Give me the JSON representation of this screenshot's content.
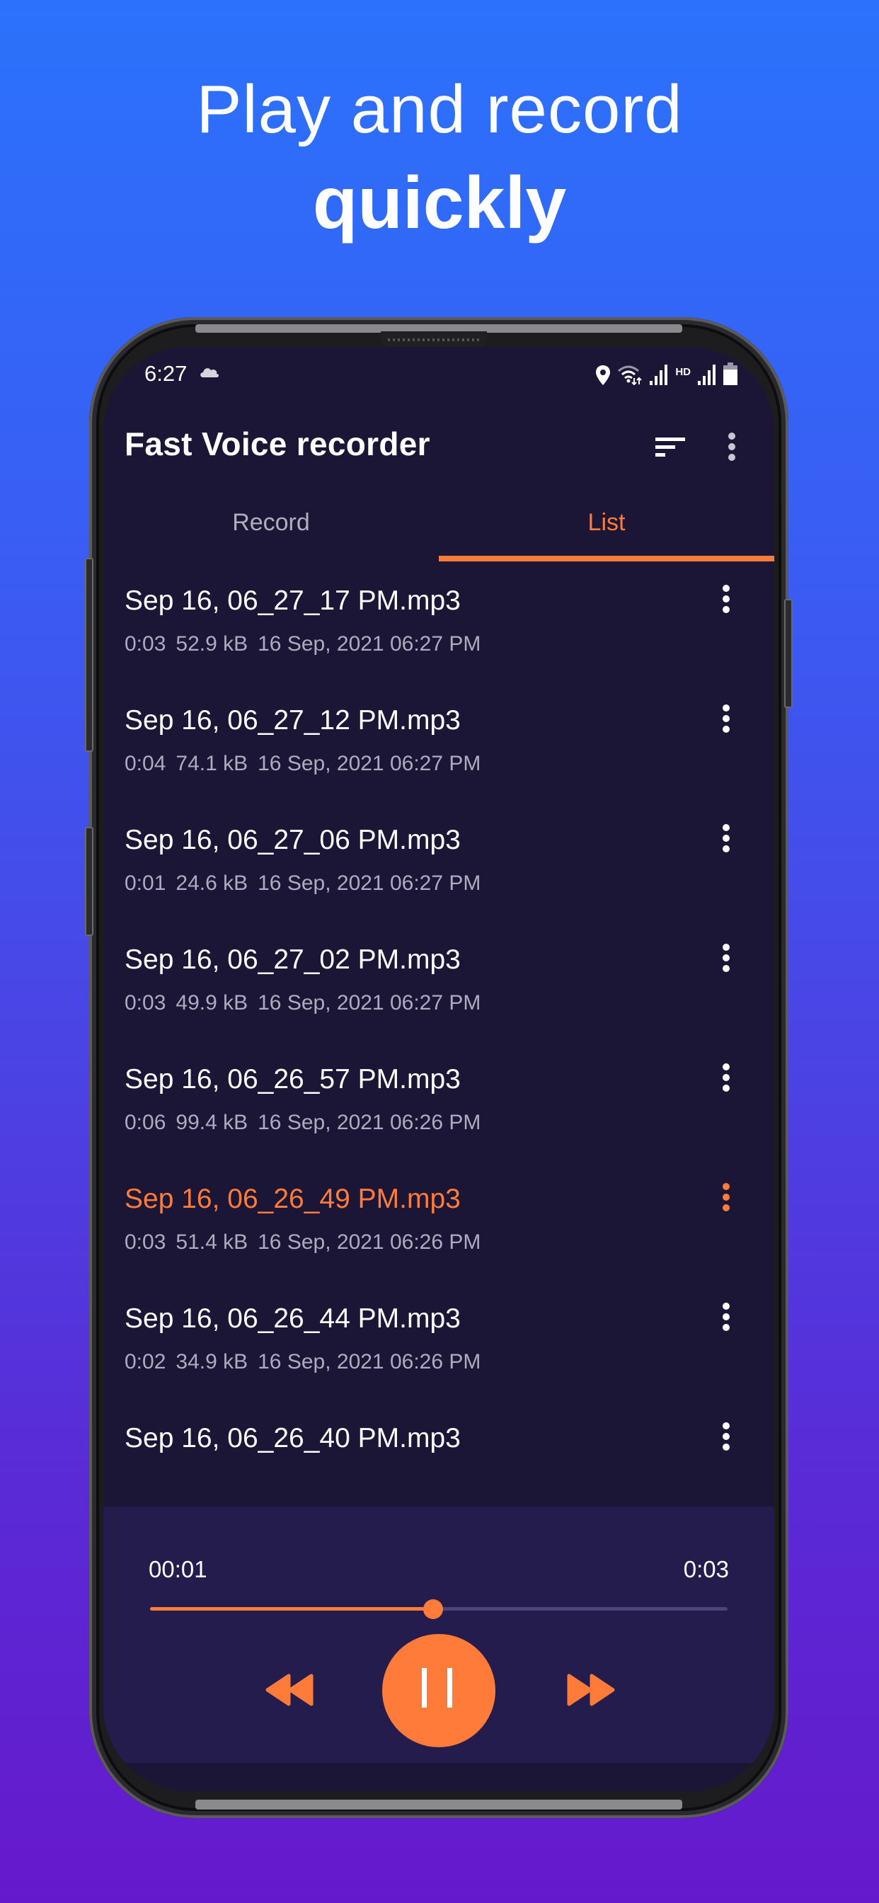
{
  "headline": {
    "line1": "Play and record",
    "line2": "quickly"
  },
  "status_bar": {
    "time": "6:27",
    "icons": [
      "cloud-icon",
      "location-icon",
      "wifi-icon",
      "signal-icon",
      "hd-label",
      "signal-icon",
      "battery-icon"
    ],
    "hd_label": "HD"
  },
  "app_bar": {
    "title": "Fast Voice recorder",
    "actions": [
      "sort-icon",
      "more-vert-icon"
    ]
  },
  "tabs": [
    {
      "label": "Record",
      "selected": false
    },
    {
      "label": "List",
      "selected": true
    }
  ],
  "files": [
    {
      "name": "Sep 16, 06_27_17 PM.mp3",
      "duration": "0:03",
      "size": "52.9 kB",
      "date": "16 Sep, 2021 06:27 PM",
      "active": false
    },
    {
      "name": "Sep 16, 06_27_12 PM.mp3",
      "duration": "0:04",
      "size": "74.1 kB",
      "date": "16 Sep, 2021 06:27 PM",
      "active": false
    },
    {
      "name": "Sep 16, 06_27_06 PM.mp3",
      "duration": "0:01",
      "size": "24.6 kB",
      "date": "16 Sep, 2021 06:27 PM",
      "active": false
    },
    {
      "name": "Sep 16, 06_27_02 PM.mp3",
      "duration": "0:03",
      "size": "49.9 kB",
      "date": "16 Sep, 2021 06:27 PM",
      "active": false
    },
    {
      "name": "Sep 16, 06_26_57 PM.mp3",
      "duration": "0:06",
      "size": "99.4 kB",
      "date": "16 Sep, 2021 06:26 PM",
      "active": false
    },
    {
      "name": "Sep 16, 06_26_49 PM.mp3",
      "duration": "0:03",
      "size": "51.4 kB",
      "date": "16 Sep, 2021 06:26 PM",
      "active": true
    },
    {
      "name": "Sep 16, 06_26_44 PM.mp3",
      "duration": "0:02",
      "size": "34.9 kB",
      "date": "16 Sep, 2021 06:26 PM",
      "active": false
    },
    {
      "name": "Sep 16, 06_26_40 PM.mp3",
      "duration": "",
      "size": "",
      "date": "",
      "active": false
    }
  ],
  "player": {
    "current_time": "00:01",
    "total_time": "0:03",
    "progress_percent": 49,
    "state": "playing",
    "controls": [
      "rewind-icon",
      "pause-icon",
      "fast-forward-icon"
    ]
  },
  "colors": {
    "accent": "#ff7b3a",
    "screen_bg": "#1b1636",
    "player_bg": "#241c4c",
    "text_primary": "#ffffff",
    "text_secondary": "#aeaabf",
    "bg_gradient_top": "#2b72fb",
    "bg_gradient_bottom": "#6519cc"
  }
}
